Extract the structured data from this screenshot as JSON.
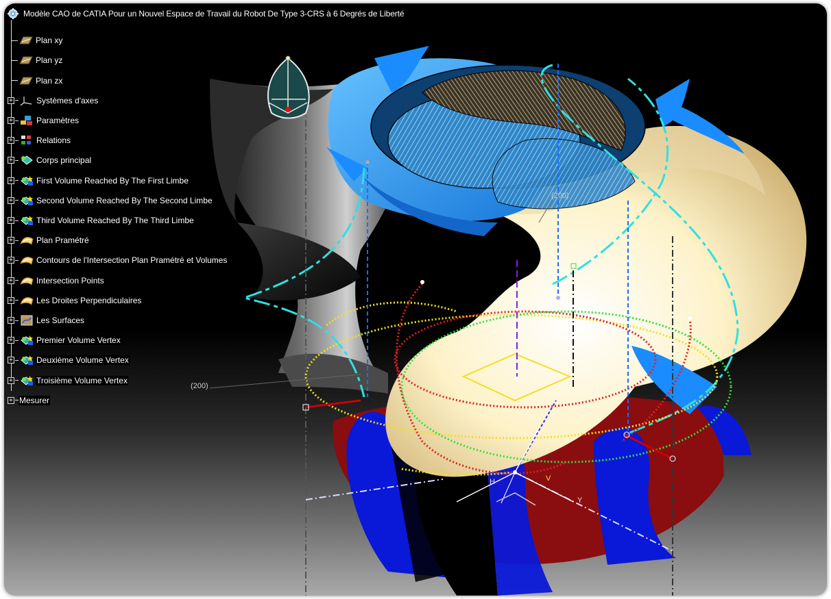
{
  "tree_title": "Modèle CAO de CATIA Pour un Nouvel Espace de Travail du Robot De Type 3-CRS à 6 Degrés de Liberté",
  "tree": [
    {
      "label": "Plan xy",
      "icon": "plane-icon",
      "expander": false
    },
    {
      "label": "Plan yz",
      "icon": "plane-icon",
      "expander": false
    },
    {
      "label": "Plan zx",
      "icon": "plane-icon",
      "expander": false
    },
    {
      "label": "Systèmes d'axes",
      "icon": "axis-system-icon",
      "expander": true
    },
    {
      "label": "Paramètres",
      "icon": "parameters-icon",
      "expander": true
    },
    {
      "label": "Relations",
      "icon": "relations-icon",
      "expander": true
    },
    {
      "label": "Corps principal",
      "icon": "part-body-icon",
      "expander": true
    },
    {
      "label": "First Volume Reached By The First Limbe",
      "icon": "volume-set-icon",
      "expander": true
    },
    {
      "label": "Second Volume Reached By The Second Limbe",
      "icon": "volume-set-icon",
      "expander": true
    },
    {
      "label": "Third Volume Reached By The Third Limbe",
      "icon": "volume-set-icon",
      "expander": true
    },
    {
      "label": "Plan Pramétré",
      "icon": "geometrical-set-icon",
      "expander": true
    },
    {
      "label": "Contours de l'Intersection Plan Pramétré et Volumes",
      "icon": "geometrical-set-icon",
      "expander": true
    },
    {
      "label": "Intersection Points",
      "icon": "geometrical-set-icon",
      "expander": true
    },
    {
      "label": "Les Droites Perpendiculaires",
      "icon": "geometrical-set-icon",
      "expander": true
    },
    {
      "label": "Les Surfaces",
      "icon": "surfaces-icon",
      "expander": true
    },
    {
      "label": "Premier Volume Vertex",
      "icon": "volume-set-icon",
      "expander": true
    },
    {
      "label": "Deuxième Volume Vertex",
      "icon": "volume-set-icon",
      "expander": true
    },
    {
      "label": "Troisième Volume Vertex",
      "icon": "volume-set-icon",
      "expander": true
    }
  ],
  "tree_last": {
    "label": "Mesurer",
    "expander": true
  },
  "dim_labels": {
    "d1": "(200)",
    "d2": "(200)"
  },
  "axis_labels": {
    "v": "V",
    "h": "H",
    "y": "Y"
  },
  "colors": {
    "blue": "#1a8cff",
    "cream": "#fff1c9",
    "cyan": "#2fe0e0",
    "red": "#c8141a",
    "navy": "#0a18d8",
    "yellow": "#f0e020",
    "green": "#30e040"
  }
}
